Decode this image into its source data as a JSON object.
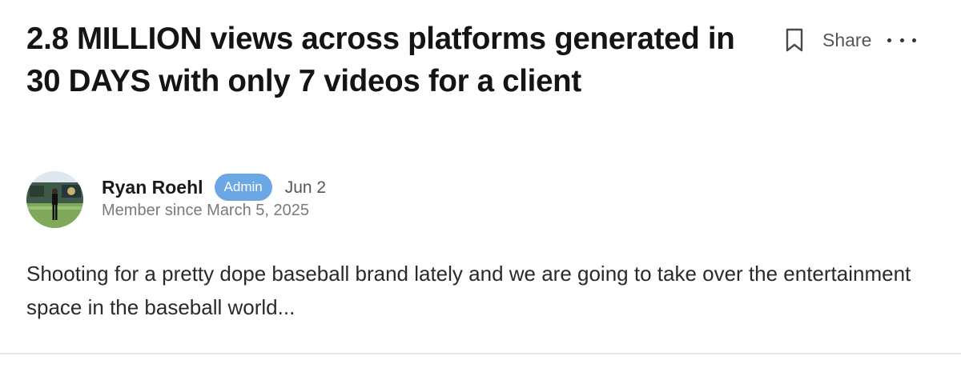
{
  "post": {
    "title": "2.8 MILLION views across platforms generated in 30 DAYS with only 7 videos for a client",
    "body": "Shooting for a pretty dope baseball brand lately and we are going to take over the entertainment space in the baseball world...",
    "author": {
      "name": "Ryan Roehl",
      "badge": "Admin",
      "date": "Jun 2",
      "member_since": "Member since March 5, 2025"
    }
  },
  "actions": {
    "bookmark_icon": "bookmark-icon",
    "share_label": "Share",
    "more_icon": "ellipsis-icon"
  },
  "colors": {
    "badge_bg": "#6aa7e4",
    "title": "#141414",
    "muted": "#7a7a7a"
  }
}
